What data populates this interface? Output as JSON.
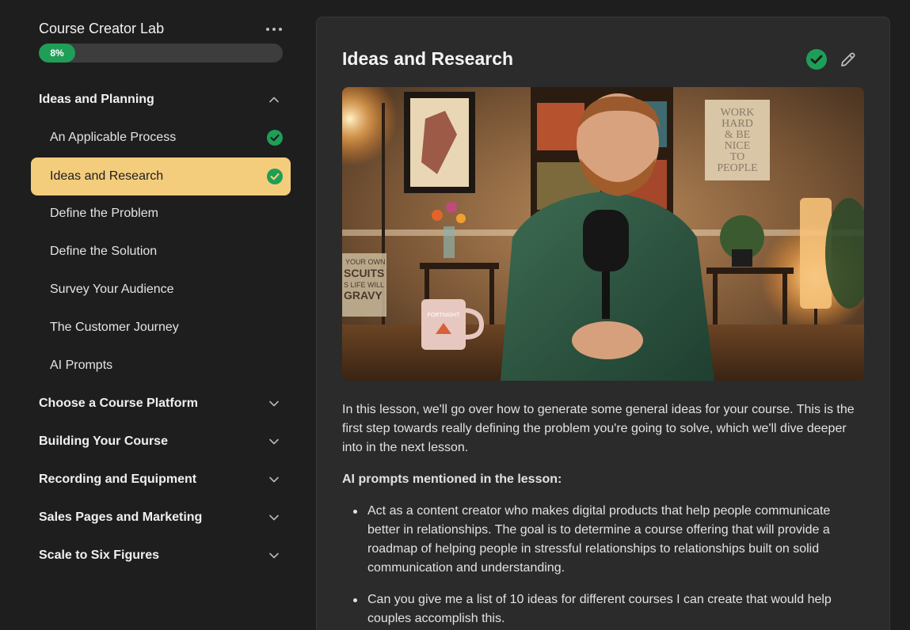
{
  "course": {
    "title": "Course Creator Lab",
    "progress_label": "8%",
    "progress_value": 0.08
  },
  "sidebar": {
    "sections": [
      {
        "label": "Ideas and Planning",
        "expanded": true,
        "lessons": [
          {
            "label": "An Applicable Process",
            "completed": true,
            "active": false
          },
          {
            "label": "Ideas and Research",
            "completed": true,
            "active": true
          },
          {
            "label": "Define the Problem",
            "completed": false,
            "active": false
          },
          {
            "label": "Define the Solution",
            "completed": false,
            "active": false
          },
          {
            "label": "Survey Your Audience",
            "completed": false,
            "active": false
          },
          {
            "label": "The Customer Journey",
            "completed": false,
            "active": false
          },
          {
            "label": "AI Prompts",
            "completed": false,
            "active": false
          }
        ]
      },
      {
        "label": "Choose a Course Platform",
        "expanded": false
      },
      {
        "label": "Building Your Course",
        "expanded": false
      },
      {
        "label": "Recording and Equipment",
        "expanded": false
      },
      {
        "label": "Sales Pages and Marketing",
        "expanded": false
      },
      {
        "label": "Scale to Six Figures",
        "expanded": false
      }
    ]
  },
  "main": {
    "title": "Ideas and Research",
    "completed": true,
    "intro": "In this lesson, we'll go over how to generate some general ideas for your course. This is the first step towards really defining the problem you're going to solve, which we'll dive deeper into in the next lesson.",
    "prompts_heading": "AI prompts mentioned in the lesson:",
    "prompts": [
      "Act as a content creator who makes digital products that help people communicate better in relationships. The goal is to determine a course offering that will provide a roadmap of helping people in stressful relationships to relationships built on solid communication and understanding.",
      "Can you give me a list of 10 ideas for different courses I can create that would help couples accomplish this."
    ],
    "video_signs": {
      "poster_lines": [
        "WORK",
        "HARD",
        "& BE",
        "NICE",
        "TO",
        "PEOPLE"
      ],
      "tote_lines": [
        "YOUR OWN",
        "SCUITS",
        "S LIFE WILL",
        "GRAVY"
      ],
      "mug_text": "FORTNIGHT"
    }
  },
  "colors": {
    "accent_active": "#f3cd7c",
    "success": "#1f9e57",
    "background": "#1e1e1e",
    "panel": "#2b2b2b"
  }
}
